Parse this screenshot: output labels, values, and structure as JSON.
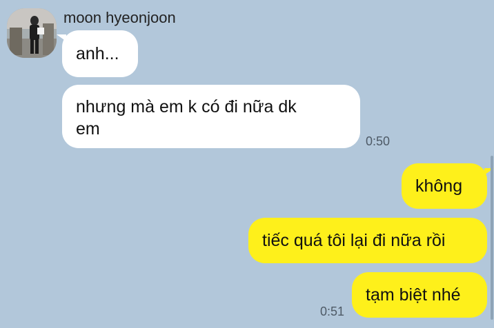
{
  "sender": {
    "name": "moon hyeonjoon"
  },
  "messages": {
    "incoming": [
      {
        "text": "anh..."
      },
      {
        "text": "nhưng mà em k có đi nữa dk em"
      }
    ],
    "incoming_time": "0:50",
    "outgoing": [
      {
        "text": "không"
      },
      {
        "text": "tiếc quá tôi lại đi nữa rồi"
      },
      {
        "text": "tạm biệt nhé"
      }
    ],
    "outgoing_time": "0:51"
  },
  "colors": {
    "background": "#b2c7da",
    "incoming_bubble": "#ffffff",
    "outgoing_bubble": "#fef01b",
    "timestamp": "#4e5a66"
  }
}
